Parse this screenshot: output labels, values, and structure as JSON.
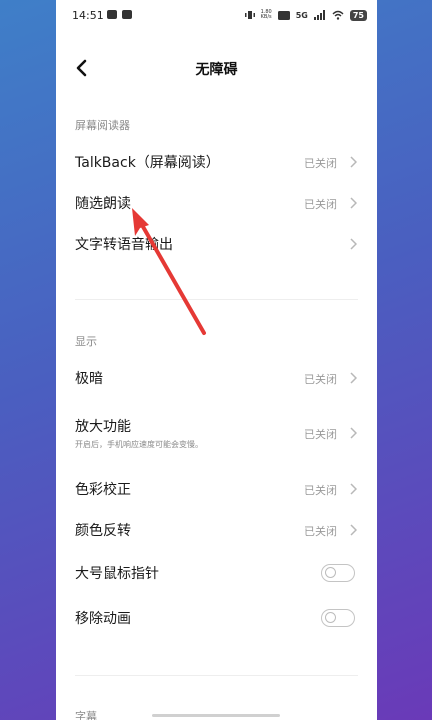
{
  "status_bar": {
    "time": "14:51",
    "net_speed": "1.80",
    "net_unit": "KB/s",
    "signal": "5G",
    "battery": "75"
  },
  "header": {
    "title": "无障碍"
  },
  "sections": {
    "screen_reader": {
      "title": "屏幕阅读器",
      "items": [
        {
          "label": "TalkBack（屏幕阅读）",
          "status": "已关闭"
        },
        {
          "label": "随选朗读",
          "status": "已关闭"
        },
        {
          "label": "文字转语音输出",
          "status": ""
        }
      ]
    },
    "display": {
      "title": "显示",
      "items": [
        {
          "label": "极暗",
          "status": "已关闭"
        },
        {
          "label": "放大功能",
          "sub": "开启后，手机响应速度可能会变慢。",
          "status": "已关闭"
        },
        {
          "label": "色彩校正",
          "status": "已关闭"
        },
        {
          "label": "颜色反转",
          "status": "已关闭"
        },
        {
          "label": "大号鼠标指针",
          "toggle_on": false
        },
        {
          "label": "移除动画",
          "toggle_on": false
        }
      ]
    },
    "captions": {
      "title": "字幕"
    }
  },
  "colors": {
    "arrow": "#e53935",
    "page_bg": "#ffffff"
  }
}
